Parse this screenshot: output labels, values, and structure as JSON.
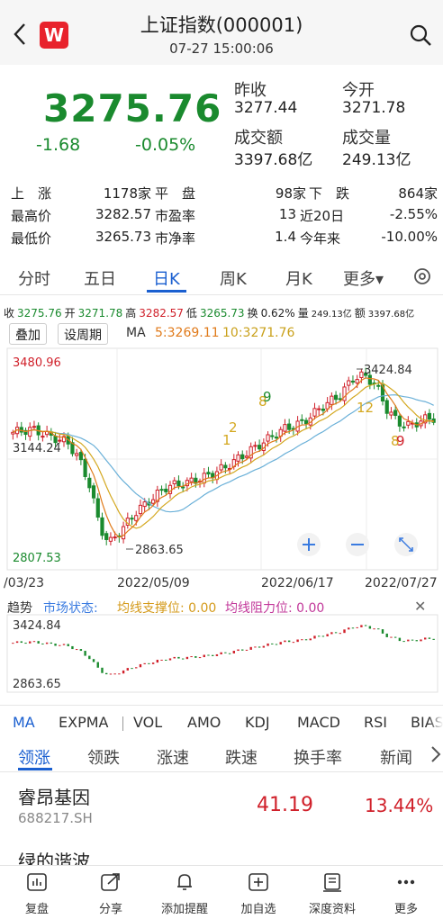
{
  "header": {
    "title": "上证指数(000001)",
    "datetime": "07-27 15:00:06",
    "logo_letter": "W"
  },
  "quote": {
    "price": "3275.76",
    "change": "-1.68",
    "change_pct": "-0.05%",
    "prev_close_label": "昨收",
    "prev_close": "3277.44",
    "open_label": "今开",
    "open": "3271.78",
    "turnover_label": "成交额",
    "turnover": "3397.68亿",
    "volume_label": "成交量",
    "volume": "249.13亿"
  },
  "stats": {
    "rise_label": "上　涨",
    "rise": "1178家",
    "flat_label": "平　盘",
    "flat": "98家",
    "fall_label": "下　跌",
    "fall": "864家",
    "high_label": "最高价",
    "high": "3282.57",
    "pe_label": "市盈率",
    "pe": "13",
    "d20_label": "近20日",
    "d20": "-2.55%",
    "low_label": "最低价",
    "low": "3265.73",
    "pb_label": "市净率",
    "pb": "1.4",
    "ytd_label": "今年来",
    "ytd": "-10.00%"
  },
  "tabs": [
    "分时",
    "五日",
    "日K",
    "周K",
    "月K",
    "更多▾"
  ],
  "ohlc": {
    "close_label": "收",
    "close": "3275.76",
    "open_label": "开",
    "open": "3271.78",
    "high_label": "高",
    "high": "3282.57",
    "low_label": "低",
    "low": "3265.73",
    "turn_label": "换",
    "turn": "0.62%",
    "vol_label": "量",
    "vol": "249.13亿",
    "amt_label": "额",
    "amt": "3397.68亿"
  },
  "chart_controls": {
    "overlay": "叠加",
    "period": "设周期",
    "ma_label": "MA",
    "ma5": "5:3269.11",
    "ma10": "10:3271.76"
  },
  "chart": {
    "y_top": "3480.96",
    "y_mid": "3144.24",
    "y_bottom": "2807.53",
    "peak_label": "3424.84",
    "trough_label": "2863.65",
    "dates": [
      "/03/23",
      "2022/05/09",
      "2022/06/17",
      "2022/07/27"
    ],
    "signal_digits": [
      "1",
      "2",
      "8",
      "9",
      "12",
      "8",
      "9"
    ]
  },
  "trend": {
    "title": "趋势",
    "market_label": "市场状态:",
    "support_label": "均线支撑位: 0.00",
    "resist_label": "均线阻力位: 0.00",
    "high": "3424.84",
    "low": "2863.65"
  },
  "indicators": [
    "MA",
    "EXPMA",
    "VOL",
    "AMO",
    "KDJ",
    "MACD",
    "RSI",
    "BIAS"
  ],
  "sub_tabs": [
    "领涨",
    "领跌",
    "涨速",
    "跌速",
    "换手率",
    "新闻"
  ],
  "stocks": [
    {
      "name": "睿昂基因",
      "code": "688217.SH",
      "price": "41.19",
      "pct": "13.44%"
    },
    {
      "name": "绿的谐波",
      "code": "",
      "price": "",
      "pct": ""
    }
  ],
  "bottom_bar": [
    "复盘",
    "分享",
    "添加提醒",
    "加自选",
    "深度资料",
    "更多"
  ],
  "colors": {
    "up": "#d0202a",
    "down": "#1a8a2e",
    "accent": "#1a5fd0",
    "ma5": "#e07a1a",
    "ma10": "#d4a820",
    "ma20": "#6ab0d8"
  }
}
